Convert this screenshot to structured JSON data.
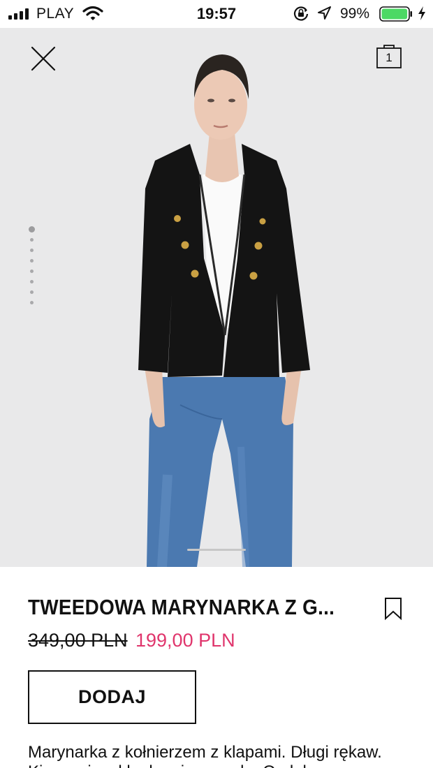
{
  "status_bar": {
    "carrier": "PLAY",
    "time": "19:57",
    "battery_percent": "99%",
    "battery_level": 0.99,
    "battery_color": "#4cd964"
  },
  "header": {
    "close_icon": "close-icon",
    "bag_icon": "shopping-bag-icon",
    "bag_count": "1"
  },
  "gallery": {
    "total_images": 8,
    "current_image": 1
  },
  "product": {
    "title": "TWEEDOWA MARYNARKA Z G...",
    "old_price": "349,00 PLN",
    "new_price": "199,00 PLN",
    "sale_color": "#e0356c",
    "add_label": "DODAJ",
    "description": "Marynarka z kołnierzem z klapami. Długi rękaw.",
    "description_line2": "Kieszenie z klapkami z przodu. Ozdobne..."
  }
}
